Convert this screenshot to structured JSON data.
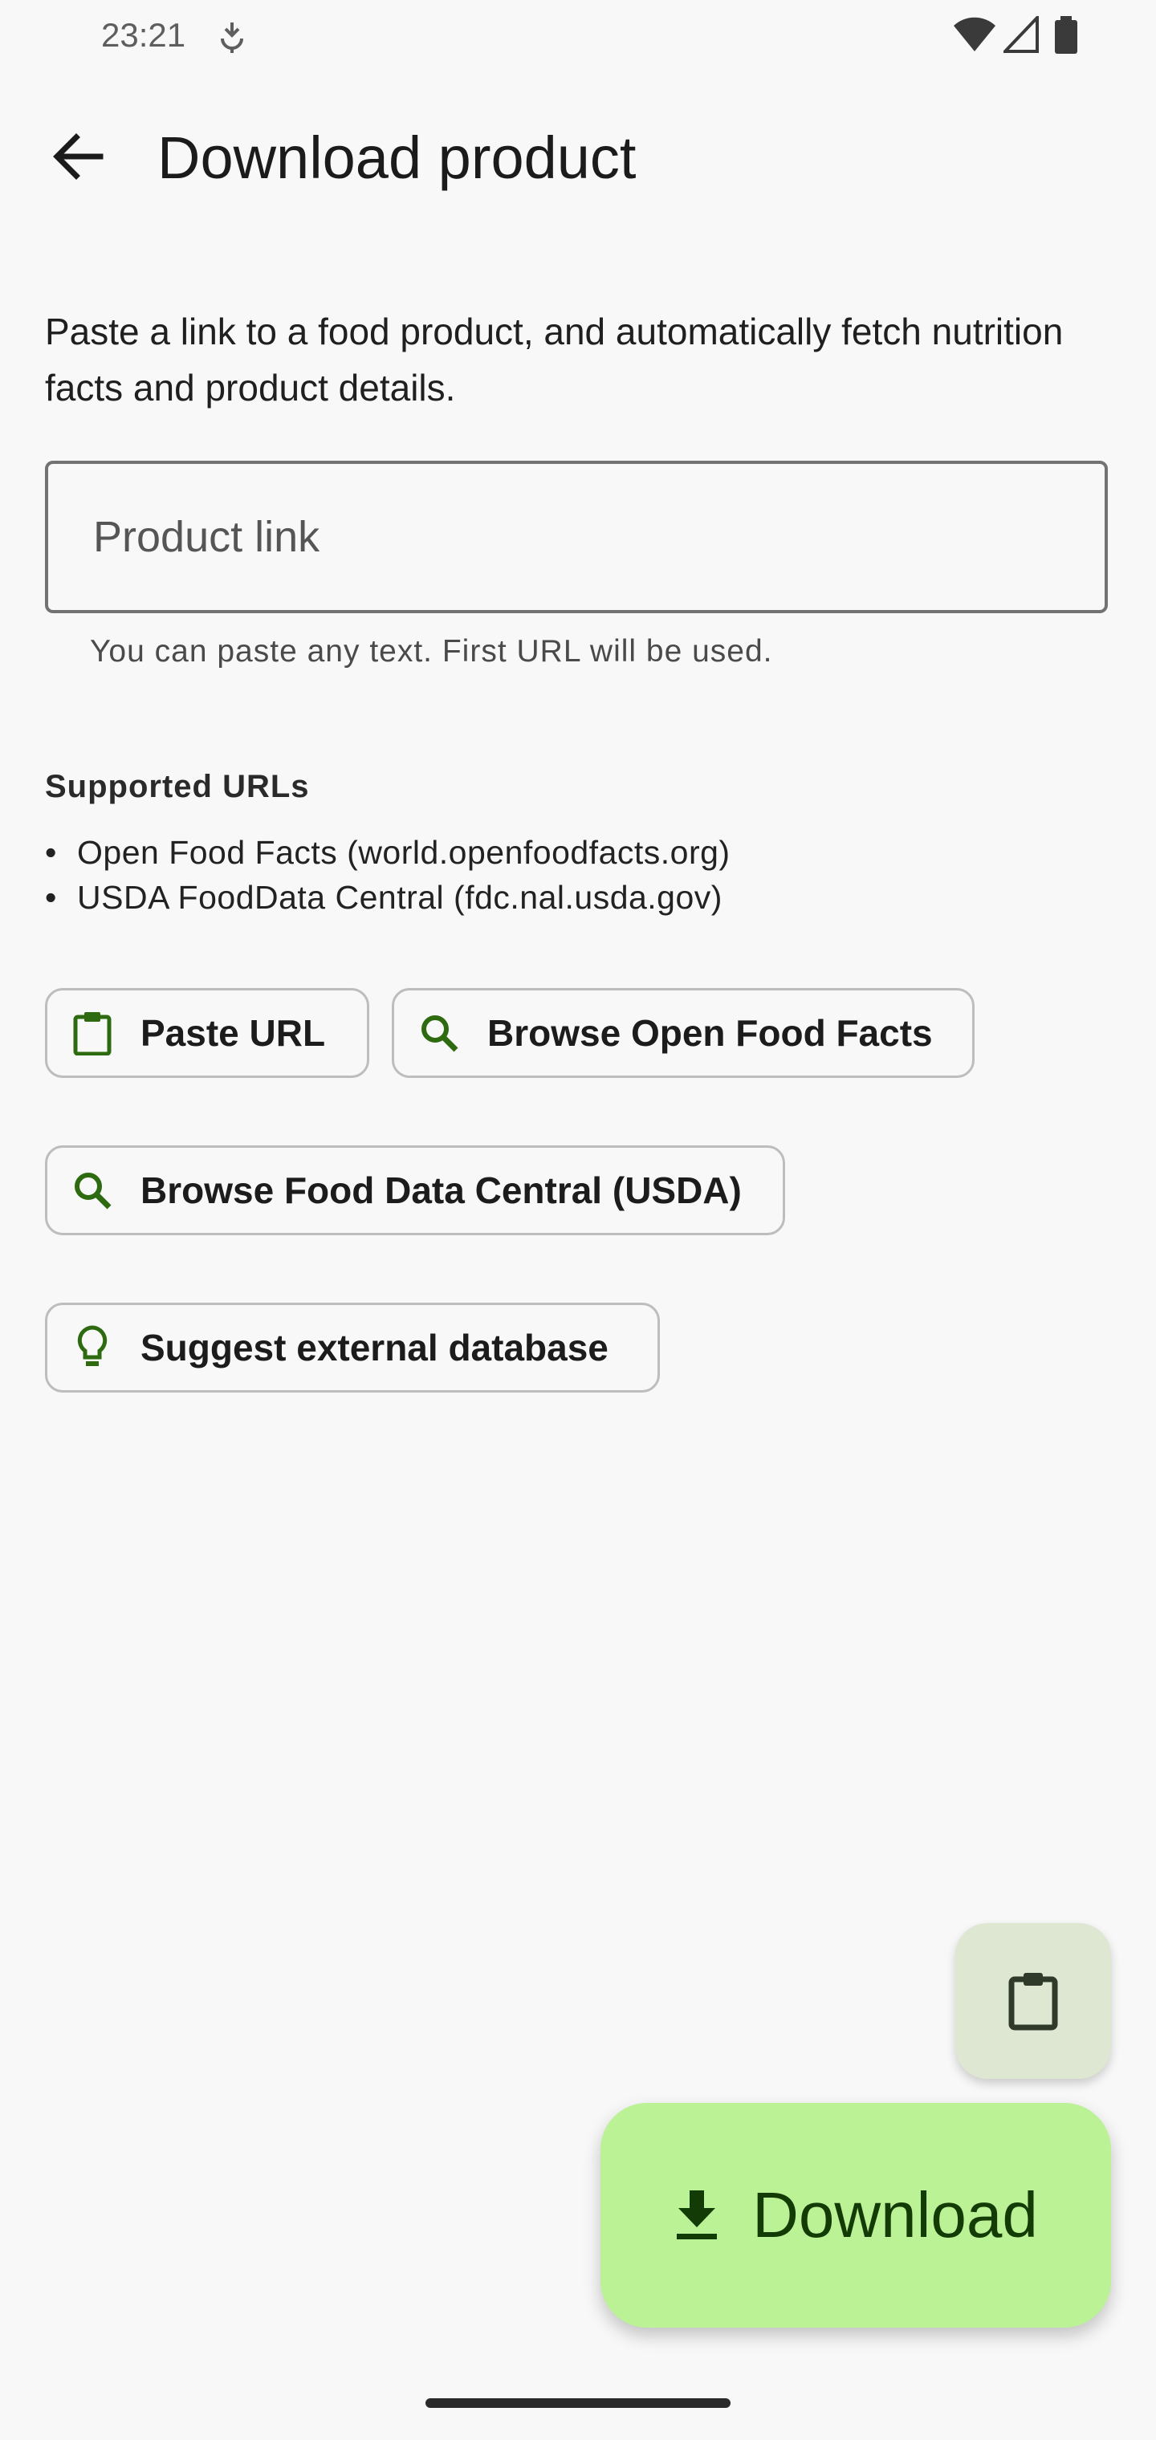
{
  "status_bar": {
    "time": "23:21",
    "icons": [
      "usb-debug-icon",
      "wifi-icon",
      "cellular-icon",
      "battery-icon"
    ]
  },
  "app_bar": {
    "back_icon": "arrow-back-icon",
    "title": "Download product"
  },
  "description": "Paste a link to a food product, and automatically fetch nutrition facts and product details.",
  "product_link": {
    "placeholder": "Product link",
    "value": "",
    "helper": "You can paste any text. First URL will be used."
  },
  "supported": {
    "title": "Supported URLs",
    "items": [
      "Open Food Facts (world.openfoodfacts.org)",
      "USDA FoodData Central (fdc.nal.usda.gov)"
    ],
    "bullet": "•"
  },
  "chips": [
    {
      "label": "Paste URL",
      "icon": "clipboard-icon"
    },
    {
      "label": "Browse Open Food Facts",
      "icon": "search-icon"
    },
    {
      "label": "Browse Food Data Central (USDA)",
      "icon": "search-icon"
    },
    {
      "label": "Suggest external database",
      "icon": "lightbulb-icon"
    }
  ],
  "fab_small": {
    "icon": "clipboard-icon"
  },
  "fab_download": {
    "label": "Download",
    "icon": "download-icon"
  },
  "colors": {
    "background": "#f8f8f8",
    "accent_icon": "#2e6b10",
    "fab_download_bg": "#bbf295",
    "fab_small_bg": "#dde7d1"
  }
}
